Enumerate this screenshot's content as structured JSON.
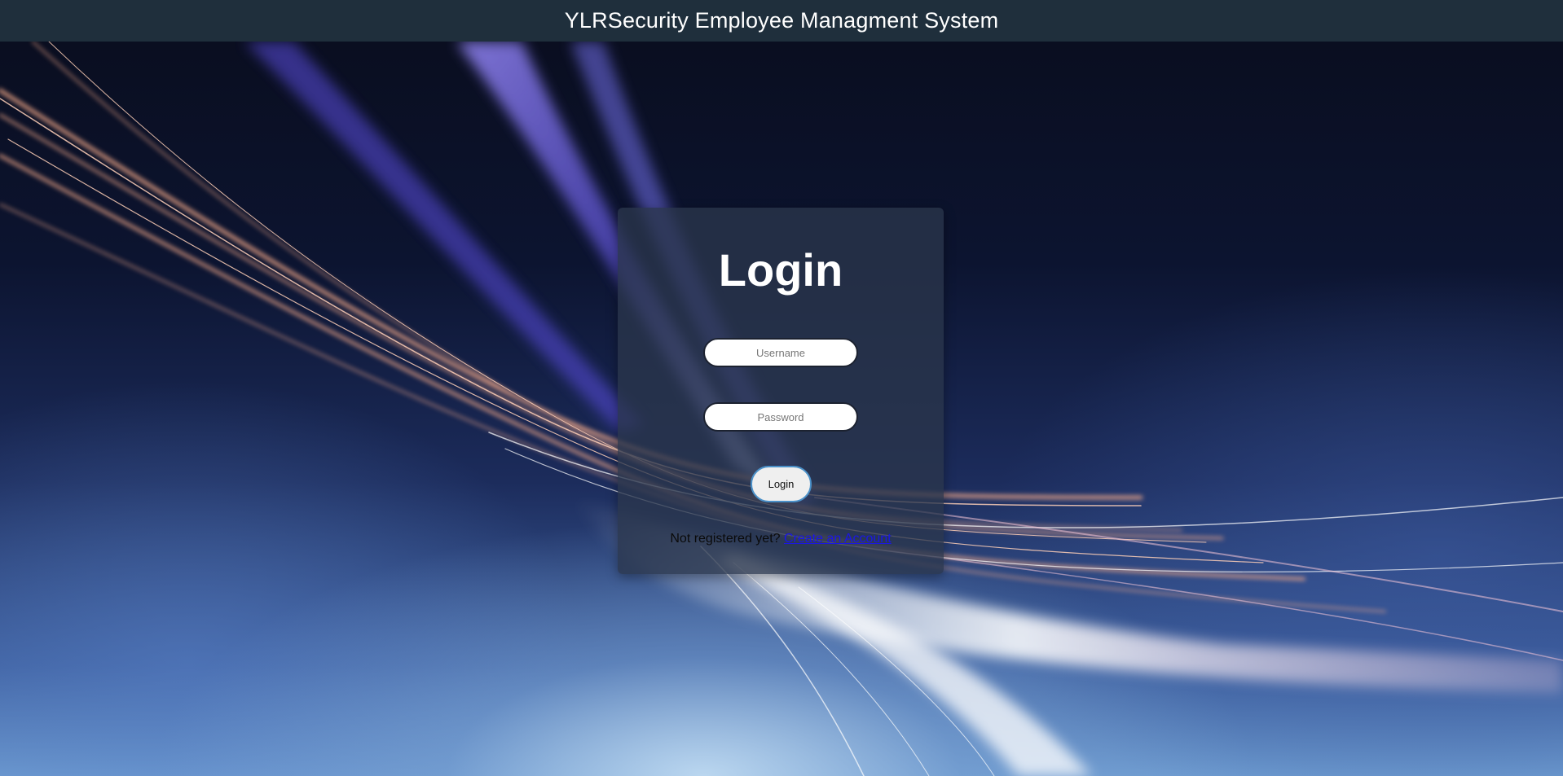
{
  "header": {
    "title": "YLRSecurity Employee Managment System"
  },
  "login": {
    "heading": "Login",
    "username_placeholder": "Username",
    "password_placeholder": "Password",
    "button_label": "Login",
    "register_prompt": "Not registered yet?",
    "register_link": "Create an Account"
  },
  "colors": {
    "header_bg": "#1f2f3c",
    "card_bg": "#2a364c",
    "link": "#1a16e6",
    "button_border": "#4a90c8"
  }
}
